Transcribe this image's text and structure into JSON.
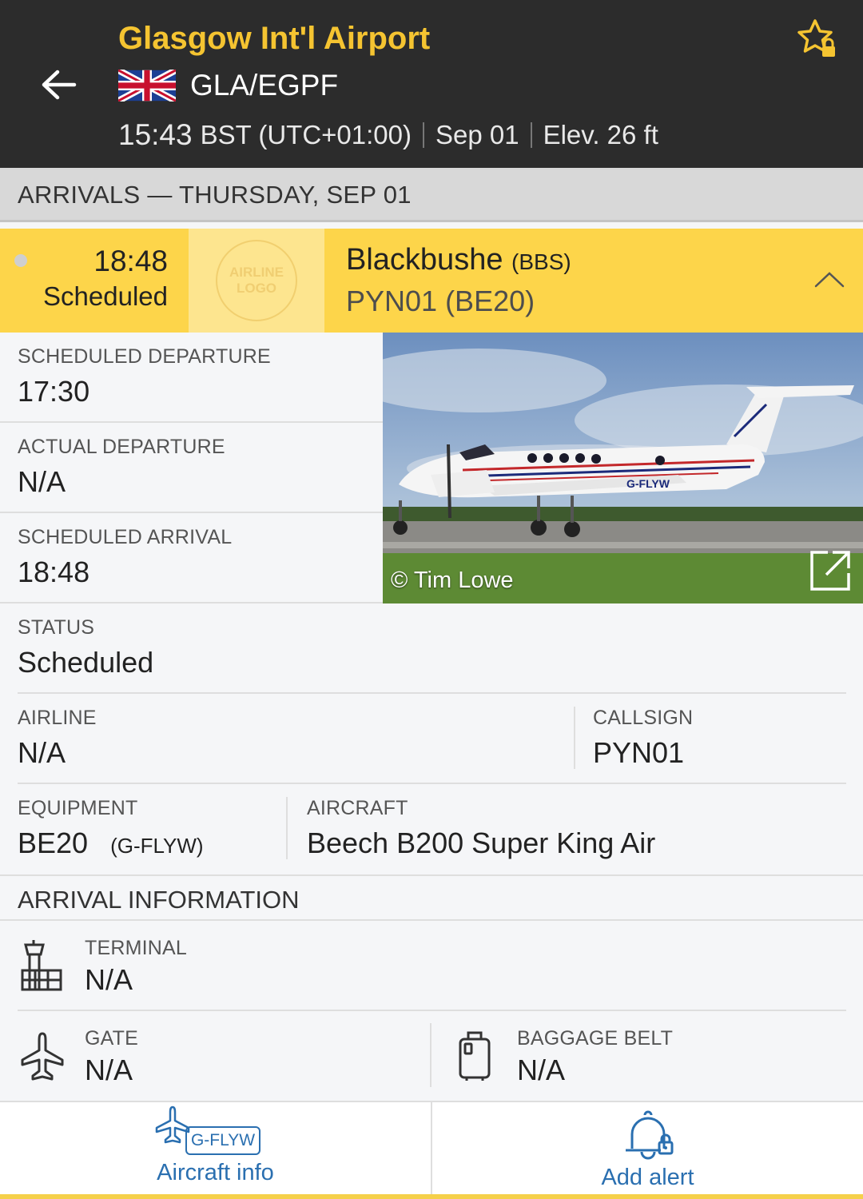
{
  "header": {
    "airport_name": "Glasgow Int'l Airport",
    "codes": "GLA/EGPF",
    "local_time": "15:43",
    "timezone": "BST (UTC+01:00)",
    "date": "Sep 01",
    "elevation": "Elev. 26 ft"
  },
  "section": {
    "title": "ARRIVALS — THURSDAY, SEP 01"
  },
  "flight": {
    "time": "18:48",
    "status": "Scheduled",
    "logo_line1": "AIRLINE",
    "logo_line2": "LOGO",
    "origin": "Blackbushe",
    "origin_code": "(BBS)",
    "flight_number": "PYN01 (BE20)"
  },
  "details": {
    "scheduled_departure_label": "SCHEDULED DEPARTURE",
    "scheduled_departure": "17:30",
    "actual_departure_label": "ACTUAL DEPARTURE",
    "actual_departure": "N/A",
    "scheduled_arrival_label": "SCHEDULED ARRIVAL",
    "scheduled_arrival": "18:48",
    "status_label": "STATUS",
    "status": "Scheduled",
    "airline_label": "AIRLINE",
    "airline": "N/A",
    "callsign_label": "CALLSIGN",
    "callsign": "PYN01",
    "equipment_label": "EQUIPMENT",
    "equipment": "BE20",
    "registration": "(G-FLYW)",
    "aircraft_label": "AIRCRAFT",
    "aircraft": "Beech B200 Super King Air"
  },
  "photo": {
    "credit": "© Tim Lowe",
    "tail_reg": "G-FLYW"
  },
  "arrival_info": {
    "title": "ARRIVAL INFORMATION",
    "terminal_label": "TERMINAL",
    "terminal": "N/A",
    "gate_label": "GATE",
    "gate": "N/A",
    "baggage_label": "BAGGAGE BELT",
    "baggage": "N/A"
  },
  "actions": {
    "aircraft_info_reg": "G-FLYW",
    "aircraft_info_label": "Aircraft info",
    "add_alert_label": "Add alert"
  },
  "colors": {
    "header_bg": "#2c2c2c",
    "brand_yellow": "#f5c431",
    "flight_row": "#fdd54a",
    "link_blue": "#2a6fb0"
  }
}
